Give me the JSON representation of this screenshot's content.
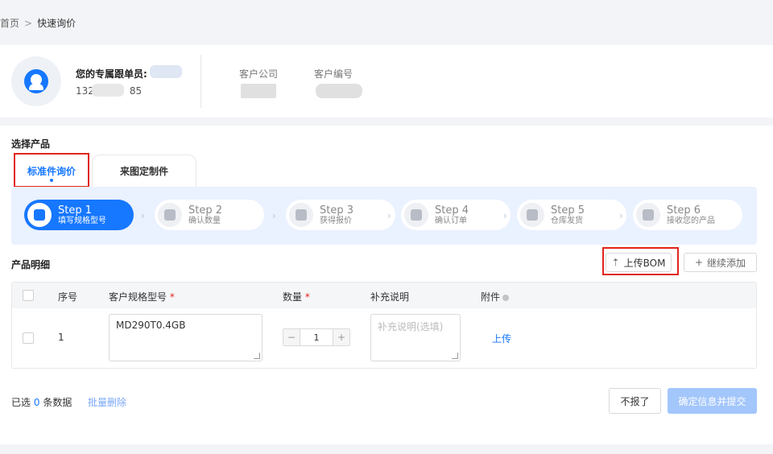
{
  "breadcrumb": {
    "home": "首页",
    "separator": ">",
    "current": "快速询价"
  },
  "rep": {
    "label": "您的专属跟单员:",
    "phone_prefix": "132",
    "phone_suffix": "85",
    "company_label": "客户公司",
    "customer_no_label": "客户编号"
  },
  "product_section": {
    "title": "选择产品",
    "tabs": [
      "标准件询价",
      "来图定制件"
    ]
  },
  "steps": [
    {
      "step": "Step 1",
      "desc": "填写规格型号"
    },
    {
      "step": "Step 2",
      "desc": "确认数量"
    },
    {
      "step": "Step 3",
      "desc": "获得报价"
    },
    {
      "step": "Step 4",
      "desc": "确认订单"
    },
    {
      "step": "Step 5",
      "desc": "仓库发货"
    },
    {
      "step": "Step 6",
      "desc": "接收您的产品"
    }
  ],
  "details": {
    "title": "产品明细",
    "upload_bom": "上传BOM",
    "continue_add": "继续添加"
  },
  "table": {
    "headers": {
      "index": "序号",
      "model": "客户规格型号",
      "quantity": "数量",
      "note": "补充说明",
      "attachment": "附件"
    },
    "required_mark": "*",
    "rows": [
      {
        "index": "1",
        "model": "MD290T0.4GB",
        "quantity": "1",
        "note_placeholder": "补充说明(选填)",
        "attachment_action": "上传"
      }
    ],
    "stepper": {
      "minus": "−",
      "plus": "+"
    }
  },
  "footer": {
    "selected_prefix": "已选",
    "selected_count": "0",
    "selected_suffix": "条数据",
    "batch_delete": "批量删除",
    "decline": "不报了",
    "submit": "确定信息并提交"
  },
  "colors": {
    "primary": "#1677ff",
    "highlight": "#e0251b",
    "submit_disabled": "#a3c6fb"
  }
}
